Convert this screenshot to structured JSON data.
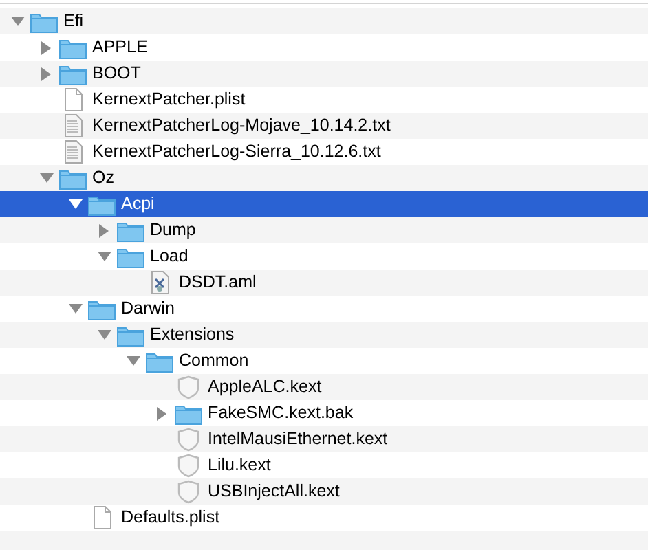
{
  "tree": [
    {
      "name": "Efi",
      "kind": "folder",
      "expanded": true,
      "selected": false,
      "children": [
        {
          "name": "APPLE",
          "kind": "folder",
          "expanded": false,
          "selected": false
        },
        {
          "name": "BOOT",
          "kind": "folder",
          "expanded": false,
          "selected": false
        },
        {
          "name": "KernextPatcher.plist",
          "kind": "document",
          "selected": false
        },
        {
          "name": "KernextPatcherLog-Mojave_10.14.2.txt",
          "kind": "text",
          "selected": false
        },
        {
          "name": "KernextPatcherLog-Sierra_10.12.6.txt",
          "kind": "text",
          "selected": false
        },
        {
          "name": "Oz",
          "kind": "folder",
          "expanded": true,
          "selected": false,
          "children": [
            {
              "name": "Acpi",
              "kind": "folder",
              "expanded": true,
              "selected": true,
              "children": [
                {
                  "name": "Dump",
                  "kind": "folder",
                  "expanded": false,
                  "selected": false
                },
                {
                  "name": "Load",
                  "kind": "folder",
                  "expanded": true,
                  "selected": false,
                  "children": [
                    {
                      "name": "DSDT.aml",
                      "kind": "aml",
                      "selected": false
                    }
                  ]
                }
              ]
            },
            {
              "name": "Darwin",
              "kind": "folder",
              "expanded": true,
              "selected": false,
              "children": [
                {
                  "name": "Extensions",
                  "kind": "folder",
                  "expanded": true,
                  "selected": false,
                  "children": [
                    {
                      "name": "Common",
                      "kind": "folder",
                      "expanded": true,
                      "selected": false,
                      "children": [
                        {
                          "name": "AppleALC.kext",
                          "kind": "kext",
                          "selected": false
                        },
                        {
                          "name": "FakeSMC.kext.bak",
                          "kind": "folder",
                          "expanded": false,
                          "selected": false
                        },
                        {
                          "name": "IntelMausiEthernet.kext",
                          "kind": "kext",
                          "selected": false
                        },
                        {
                          "name": "Lilu.kext",
                          "kind": "kext",
                          "selected": false
                        },
                        {
                          "name": "USBInjectAll.kext",
                          "kind": "kext",
                          "selected": false
                        }
                      ]
                    }
                  ]
                }
              ]
            },
            {
              "name": "Defaults.plist",
              "kind": "document",
              "selected": false
            }
          ]
        }
      ]
    }
  ]
}
